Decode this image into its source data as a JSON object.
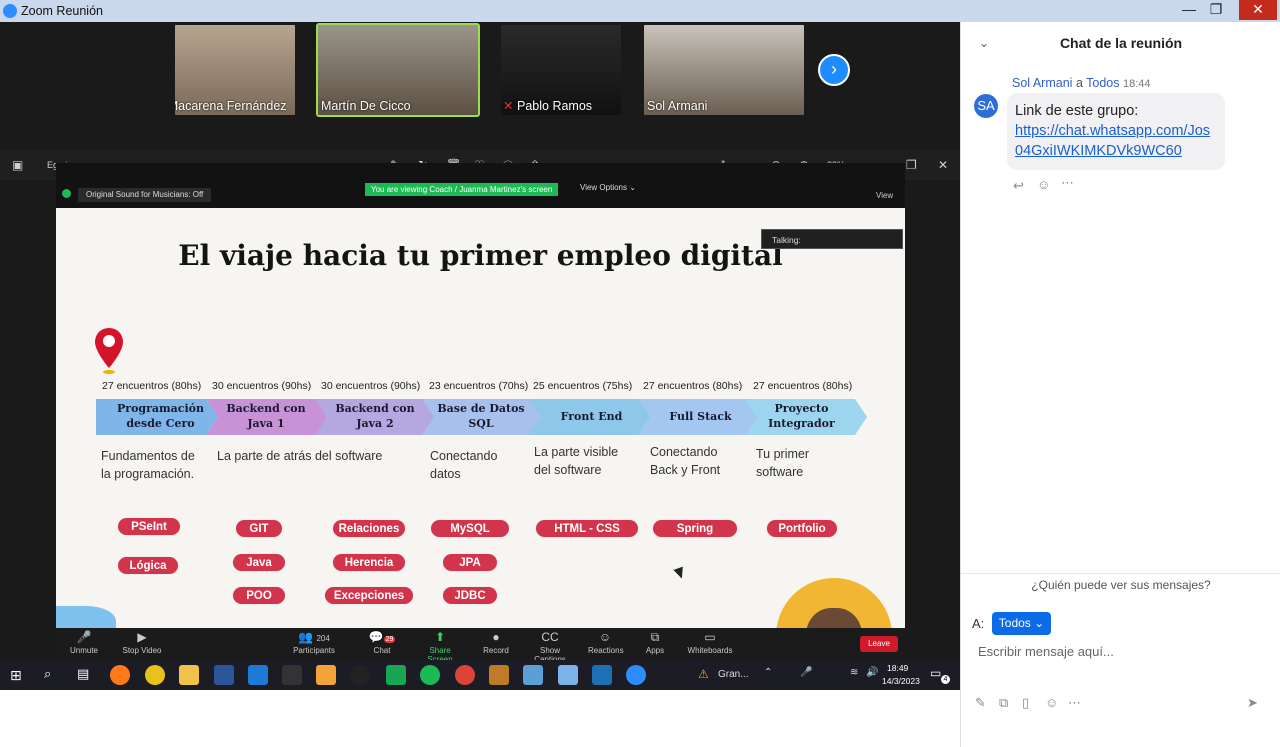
{
  "window": {
    "title": "Zoom Reunión",
    "minimize": "—",
    "restore": "❐",
    "close": "✕"
  },
  "participants": [
    {
      "name": "J Macarena Fernández"
    },
    {
      "name": "Martín De Cicco"
    },
    {
      "name": "Pablo Ramos"
    },
    {
      "name": "Sol Armani"
    }
  ],
  "viewer": {
    "filename": "Egg.jpg",
    "zoom": "88%"
  },
  "share": {
    "sound": "Original Sound for Musicians: Off",
    "viewing": "You are viewing Coach / Juanma Martinez's screen",
    "view_options": "View Options ⌄",
    "view": "View",
    "talking": "Talking:"
  },
  "slide": {
    "title": "El viaje hacia tu primer empleo digital",
    "stages": [
      {
        "hours": "27 encuentros (80hs)",
        "label": "Programación desde Cero",
        "desc": "Fundamentos de la programación.",
        "tags": [
          "PSeInt",
          "Lógica"
        ]
      },
      {
        "hours": "30 encuentros (90hs)",
        "label": "Backend con Java 1",
        "desc": "La parte de atrás del software",
        "tags": [
          "GIT",
          "Java",
          "POO"
        ]
      },
      {
        "hours": "30 encuentros (90hs)",
        "label": "Backend con Java 2",
        "desc": "",
        "tags": [
          "Relaciones",
          "Herencia",
          "Excepciones"
        ]
      },
      {
        "hours": "23 encuentros (70hs)",
        "label": "Base de Datos SQL",
        "desc": "Conectando datos",
        "tags": [
          "MySQL",
          "JPA",
          "JDBC"
        ]
      },
      {
        "hours": "25 encuentros (75hs)",
        "label": "Front End",
        "desc": "La parte visible del software",
        "tags": [
          "HTML - CSS"
        ]
      },
      {
        "hours": "27 encuentros (80hs)",
        "label": "Full Stack",
        "desc": "Conectando Back y Front",
        "tags": [
          "Spring"
        ]
      },
      {
        "hours": "27 encuentros (80hs)",
        "label": "Proyecto Integrador",
        "desc": "Tu primer software",
        "tags": [
          "Portfolio"
        ]
      }
    ]
  },
  "toolbar": {
    "unmute": "Unmute",
    "stop_video": "Stop Video",
    "participants": "Participants",
    "participant_count": "204",
    "chat": "Chat",
    "chat_badge": "29",
    "share_screen": "Share Screen",
    "record": "Record",
    "captions": "Show Captions",
    "reactions": "Reactions",
    "apps": "Apps",
    "whiteboards": "Whiteboards",
    "leave": "Leave"
  },
  "taskbar": {
    "time": "18:49",
    "date": "14/3/2023",
    "alert": "Gran...",
    "notif_count": "4"
  },
  "chat": {
    "title": "Chat de la reunión",
    "sender": "Sol Armani",
    "to_word": "a",
    "recipient": "Todos",
    "time": "18:44",
    "avatar": "SA",
    "message": "Link de este grupo:",
    "link": "https://chat.whatsapp.com/Jos04GxiIWKIMKDVk9WC60",
    "who_can_see": "¿Quién puede ver sus mensajes?",
    "to_label": "A:",
    "to_value": "Todos ⌄",
    "placeholder": "Escribir mensaje aquí..."
  },
  "colors": {
    "accent": "#0e6be8",
    "tag": "#d2344b",
    "share_green": "#1db954"
  }
}
